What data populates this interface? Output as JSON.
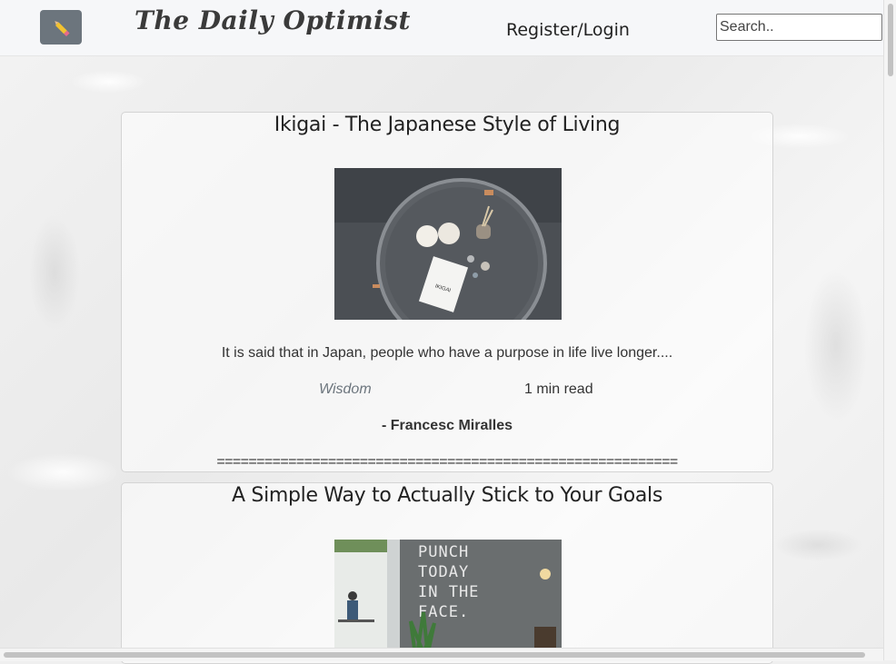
{
  "navbar": {
    "brand": "The Daily Optimist",
    "register_login": "Register/Login",
    "search_placeholder": "Search.."
  },
  "posts": [
    {
      "title": "Ikigai - The Japanese Style of Living",
      "excerpt": "It is said that in Japan, people who have a purpose in life live longer....",
      "category": "Wisdom",
      "read_time": "1 min read",
      "author": "- Francesc Miralles",
      "divider": "=========================================================="
    },
    {
      "title": "A Simple Way to Actually Stick to Your Goals",
      "image_text": "PUNCH TODAY IN THE FACE."
    }
  ],
  "colors": {
    "navbar_bg": "#f6f7f9",
    "logo_button": "#6c757d",
    "category_text": "#6c757d"
  }
}
